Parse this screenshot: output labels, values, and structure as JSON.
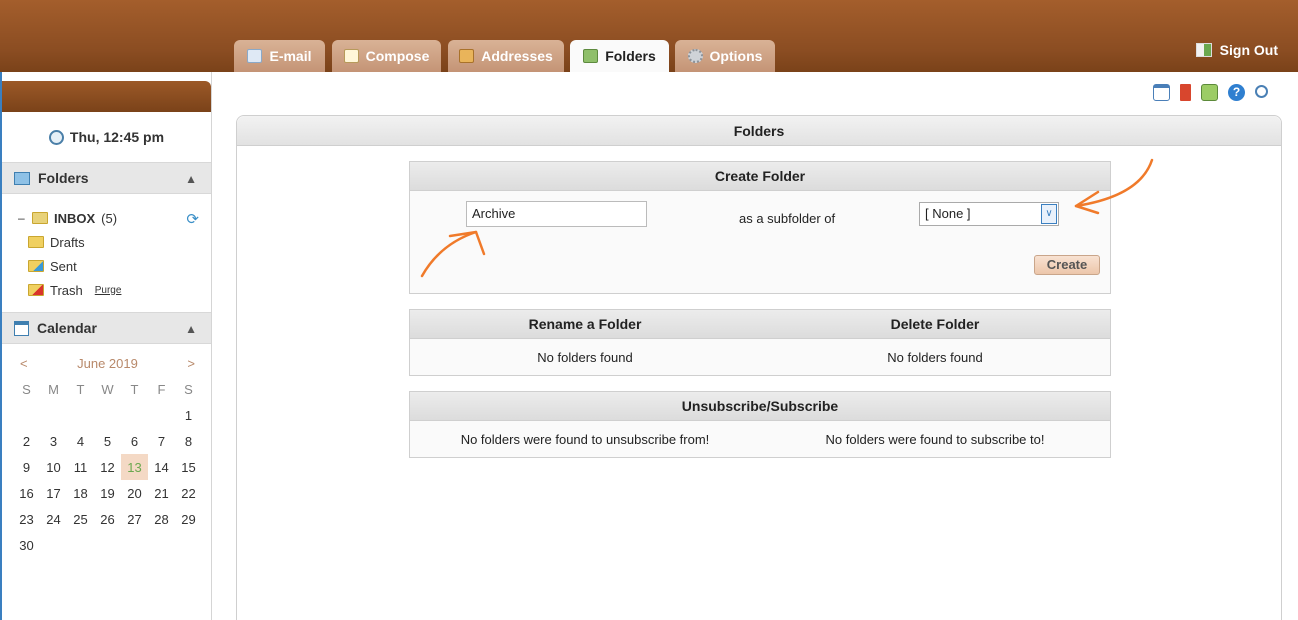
{
  "tabs": [
    {
      "label": "E-mail",
      "icon": "mail-icon"
    },
    {
      "label": "Compose",
      "icon": "compose-icon"
    },
    {
      "label": "Addresses",
      "icon": "addressbook-icon"
    },
    {
      "label": "Folders",
      "icon": "folder-icon",
      "active": true
    },
    {
      "label": "Options",
      "icon": "gear-icon"
    }
  ],
  "signout": {
    "label": "Sign Out"
  },
  "sidebar": {
    "clock": "Thu, 12:45 pm",
    "folders_title": "Folders",
    "inbox": {
      "name": "INBOX",
      "count": "(5)"
    },
    "drafts": "Drafts",
    "sent": "Sent",
    "trash": "Trash",
    "purge": "Purge",
    "calendar_title": "Calendar",
    "calendar": {
      "prev": "<",
      "month": "June 2019",
      "next": ">",
      "weekdays": [
        "S",
        "M",
        "T",
        "W",
        "T",
        "F",
        "S"
      ],
      "days": [
        "",
        "",
        "",
        "",
        "",
        "",
        "1",
        "2",
        "3",
        "4",
        "5",
        "6",
        "7",
        "8",
        "9",
        "10",
        "11",
        "12",
        "13",
        "14",
        "15",
        "16",
        "17",
        "18",
        "19",
        "20",
        "21",
        "22",
        "23",
        "24",
        "25",
        "26",
        "27",
        "28",
        "29",
        "30"
      ],
      "today": "13"
    }
  },
  "main": {
    "title": "Folders",
    "create": {
      "title": "Create Folder",
      "input_value": "Archive",
      "subfolder_label": "as a subfolder of",
      "parent_selected": "[ None ]",
      "button": "Create"
    },
    "rename": {
      "title": "Rename a Folder",
      "empty": "No folders found"
    },
    "delete": {
      "title": "Delete Folder",
      "empty": "No folders found"
    },
    "subscribe": {
      "title": "Unsubscribe/Subscribe",
      "unsub_empty": "No folders were found to unsubscribe from!",
      "sub_empty": "No folders were found to subscribe to!"
    }
  },
  "colors": {
    "brand": "#8b4d22",
    "tab": "#c49476",
    "annotation": "#f07a2a",
    "today": "#f4d9c5"
  }
}
